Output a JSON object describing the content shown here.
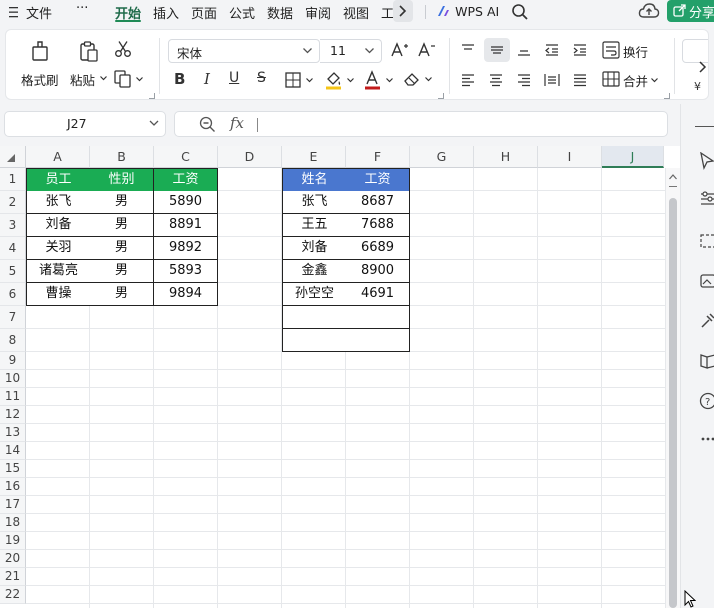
{
  "menu": {
    "file": "文件",
    "more": "···",
    "tabs": [
      "开始",
      "插入",
      "页面",
      "公式",
      "数据",
      "审阅",
      "视图",
      "工"
    ],
    "wps_ai": "WPS AI",
    "share": "分享"
  },
  "ribbon": {
    "format_painter": "格式刷",
    "paste": "粘贴",
    "font_name": "宋体",
    "font_size": "11",
    "wrap_text": "换行",
    "merge": "合并"
  },
  "formula_bar": {
    "name_box": "J27",
    "fx": "fx",
    "content": ""
  },
  "grid": {
    "columns": [
      "A",
      "B",
      "C",
      "D",
      "E",
      "F",
      "G",
      "H",
      "I",
      "J"
    ],
    "selected_column": "J",
    "rows": [
      "1",
      "2",
      "3",
      "4",
      "5",
      "6",
      "7",
      "8",
      "9",
      "10",
      "11",
      "12",
      "13",
      "14",
      "15",
      "16",
      "17",
      "18",
      "19",
      "20",
      "21",
      "22"
    ],
    "table1": {
      "headers": [
        "员工",
        "性别",
        "工资"
      ],
      "rows": [
        [
          "张飞",
          "男",
          "5890"
        ],
        [
          "刘备",
          "男",
          "8891"
        ],
        [
          "关羽",
          "男",
          "9892"
        ],
        [
          "诸葛亮",
          "男",
          "5893"
        ],
        [
          "曹操",
          "男",
          "9894"
        ]
      ],
      "header_color": "#1aac54"
    },
    "table2": {
      "headers": [
        "姓名",
        "工资"
      ],
      "rows": [
        [
          "张飞",
          "8687"
        ],
        [
          "王五",
          "7688"
        ],
        [
          "刘备",
          "6689"
        ],
        [
          "金鑫",
          "8900"
        ],
        [
          "孙空空",
          "4691"
        ],
        [
          "",
          ""
        ],
        [
          "",
          ""
        ]
      ],
      "header_color": "#4a77cf"
    }
  },
  "colors": {
    "accent_green": "#1f8a56",
    "share_button": "#23a06a"
  }
}
